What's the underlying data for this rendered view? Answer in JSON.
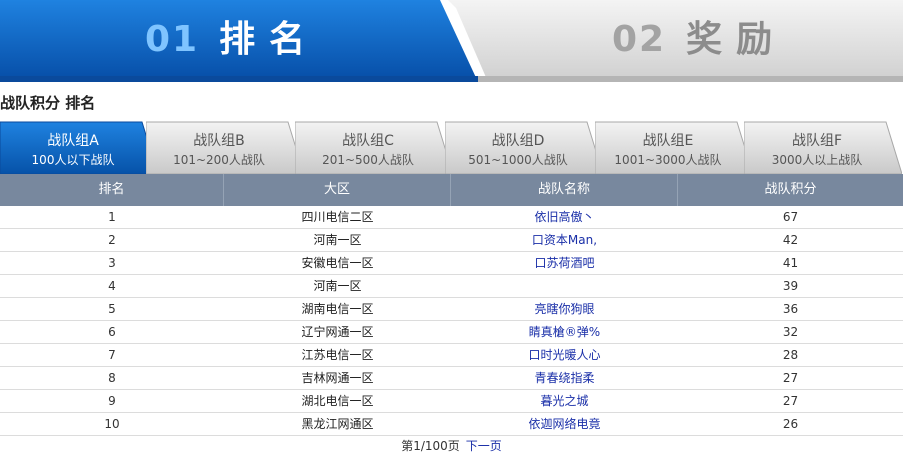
{
  "top_tabs": [
    {
      "num": "01",
      "label": "排名",
      "active": true
    },
    {
      "num": "02",
      "label": "奖励",
      "active": false
    }
  ],
  "section_title": "战队积分 排名",
  "group_tabs": [
    {
      "name": "战队组A",
      "desc": "100人以下战队",
      "active": true
    },
    {
      "name": "战队组B",
      "desc": "101~200人战队",
      "active": false
    },
    {
      "name": "战队组C",
      "desc": "201~500人战队",
      "active": false
    },
    {
      "name": "战队组D",
      "desc": "501~1000人战队",
      "active": false
    },
    {
      "name": "战队组E",
      "desc": "1001~3000人战队",
      "active": false
    },
    {
      "name": "战队组F",
      "desc": "3000人以上战队",
      "active": false
    }
  ],
  "table": {
    "headers": [
      "排名",
      "大区",
      "战队名称",
      "战队积分"
    ],
    "rows": [
      {
        "rank": "1",
        "region": "四川电信二区",
        "team": "依旧高傲丶",
        "score": "67"
      },
      {
        "rank": "2",
        "region": "河南一区",
        "team": "口资本Man,",
        "score": "42"
      },
      {
        "rank": "3",
        "region": "安徽电信一区",
        "team": "口苏荷酒吧",
        "score": "41"
      },
      {
        "rank": "4",
        "region": "河南一区",
        "team": "",
        "score": "39"
      },
      {
        "rank": "5",
        "region": "湖南电信一区",
        "team": "亮瞎你狗眼",
        "score": "36"
      },
      {
        "rank": "6",
        "region": "辽宁网通一区",
        "team": "睛真槍®弹%",
        "score": "32"
      },
      {
        "rank": "7",
        "region": "江苏电信一区",
        "team": "口时光暖人心",
        "score": "28"
      },
      {
        "rank": "8",
        "region": "吉林网通一区",
        "team": "青春绕指柔",
        "score": "27"
      },
      {
        "rank": "9",
        "region": "湖北电信一区",
        "team": "暮光之城",
        "score": "27"
      },
      {
        "rank": "10",
        "region": "黑龙江网通区",
        "team": "依迦网络电竟",
        "score": "26"
      }
    ]
  },
  "pager": {
    "page_text": "第1/100页",
    "next_label": "下一页"
  },
  "colors": {
    "active_blue": "#0a63c2",
    "header_gray": "#78889e",
    "link_blue": "#1a2fa8"
  }
}
